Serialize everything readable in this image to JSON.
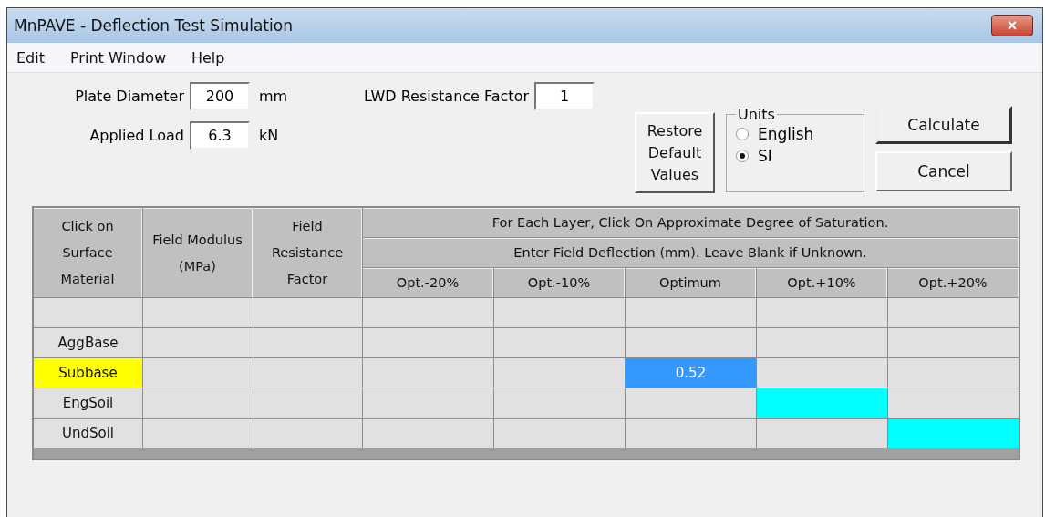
{
  "window": {
    "title": "MnPAVE - Deflection Test Simulation",
    "close_label": "×"
  },
  "menu": [
    "Edit",
    "Print Window",
    "Help"
  ],
  "inputs": {
    "plate_diameter": {
      "label": "Plate Diameter",
      "value": "200",
      "unit": "mm"
    },
    "applied_load": {
      "label": "Applied Load",
      "value": "6.3",
      "unit": "kN"
    },
    "lwd_factor": {
      "label": "LWD Resistance Factor",
      "value": "1"
    }
  },
  "restore_button": "Restore Default Values",
  "units": {
    "title": "Units",
    "options": [
      {
        "label": "English",
        "selected": false
      },
      {
        "label": "SI",
        "selected": true
      }
    ]
  },
  "buttons": [
    {
      "label": "Calculate",
      "default": true
    },
    {
      "label": "Cancel",
      "default": false
    }
  ],
  "table": {
    "fixed_columns": [
      "Click on Surface Material",
      "Field Modulus (MPa)",
      "Field Resistance Factor"
    ],
    "banner_lines": [
      "For Each Layer, Click On Approximate Degree of Saturation.",
      "Enter Field Deflection (mm). Leave Blank if Unknown."
    ],
    "saturation_columns": [
      "Opt.-20%",
      "Opt.-10%",
      "Optimum",
      "Opt.+10%",
      "Opt.+20%"
    ],
    "rows": [
      {
        "selected": false,
        "cells": [
          {
            "selected": false,
            "focused": false
          },
          {
            "selected": false,
            "focused": false
          },
          {
            "selected": false,
            "focused": false
          },
          {
            "selected": false,
            "focused": false
          },
          {
            "selected": false,
            "focused": false
          }
        ]
      },
      {
        "material": "AggBase",
        "selected": false,
        "cells": [
          {
            "selected": false,
            "focused": false
          },
          {
            "selected": false,
            "focused": false
          },
          {
            "selected": false,
            "focused": false
          },
          {
            "selected": false,
            "focused": false
          },
          {
            "selected": false,
            "focused": false
          }
        ]
      },
      {
        "material": "Subbase",
        "selected": true,
        "cells": [
          {
            "selected": false,
            "focused": false
          },
          {
            "selected": false,
            "focused": false
          },
          {
            "selected": true,
            "focused": true,
            "value": "0.52"
          },
          {
            "selected": false,
            "focused": false
          },
          {
            "selected": false,
            "focused": false
          }
        ]
      },
      {
        "material": "EngSoil",
        "selected": false,
        "cells": [
          {
            "selected": false,
            "focused": false
          },
          {
            "selected": false,
            "focused": false
          },
          {
            "selected": false,
            "focused": false
          },
          {
            "selected": true,
            "focused": false
          },
          {
            "selected": false,
            "focused": false
          }
        ]
      },
      {
        "material": "UndSoil",
        "selected": false,
        "cells": [
          {
            "selected": false,
            "focused": false
          },
          {
            "selected": false,
            "focused": false
          },
          {
            "selected": false,
            "focused": false
          },
          {
            "selected": false,
            "focused": false
          },
          {
            "selected": true,
            "focused": false
          }
        ]
      }
    ]
  }
}
